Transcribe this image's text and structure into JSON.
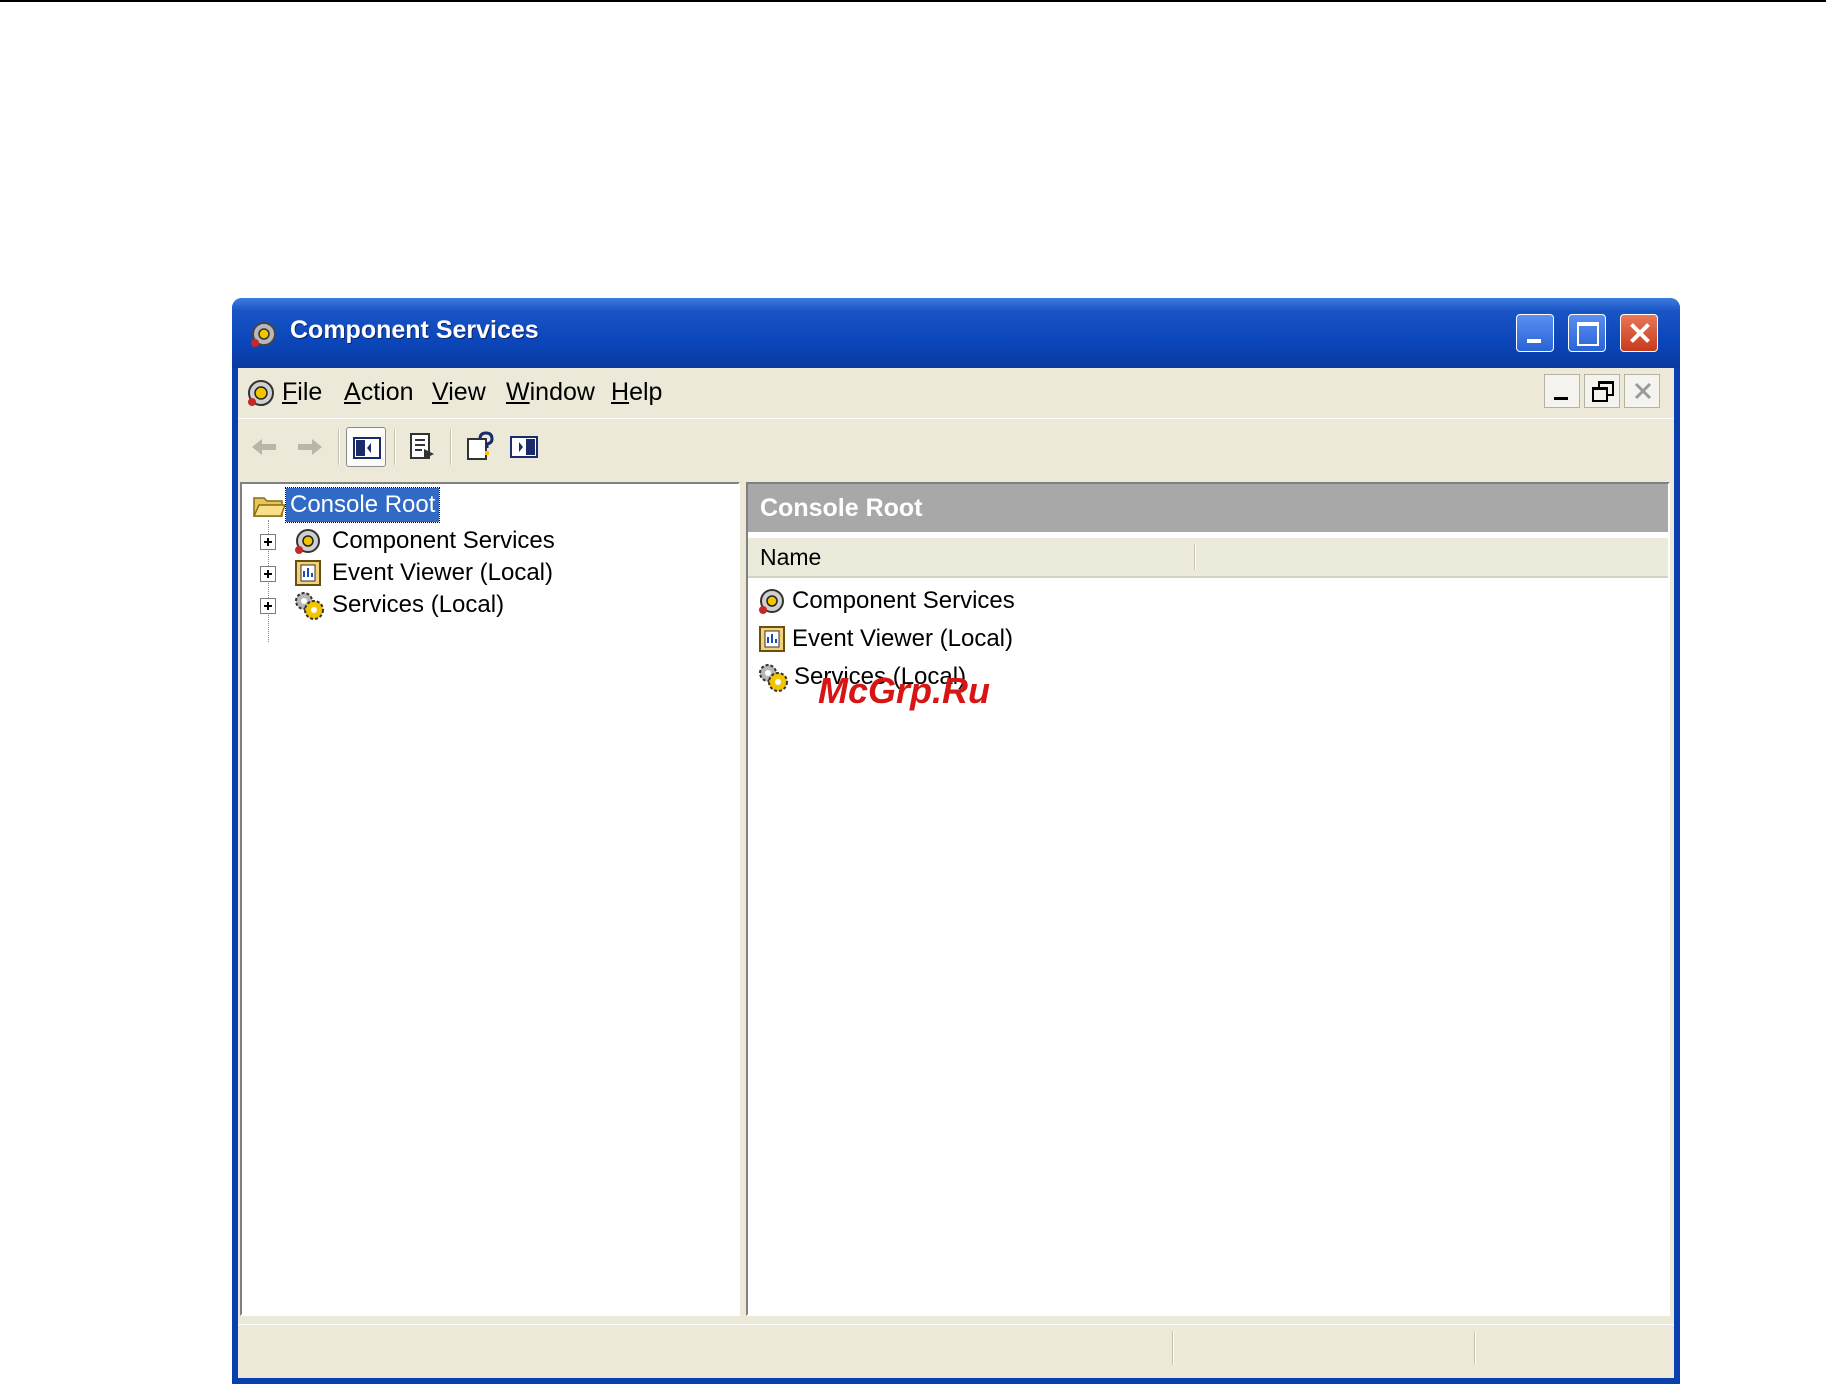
{
  "window": {
    "title": "Component Services"
  },
  "menubar": {
    "items": [
      {
        "label_mnemonic": "F",
        "label_rest": "ile"
      },
      {
        "label_mnemonic": "A",
        "label_rest": "ction"
      },
      {
        "label_mnemonic": "V",
        "label_rest": "iew"
      },
      {
        "label_mnemonic": "W",
        "label_rest": "indow"
      },
      {
        "label_mnemonic": "H",
        "label_rest": "elp"
      }
    ]
  },
  "tree": {
    "root_label": "Console Root",
    "items": [
      {
        "label": "Component Services",
        "icon": "component-services-icon"
      },
      {
        "label": "Event Viewer (Local)",
        "icon": "event-viewer-icon"
      },
      {
        "label": "Services (Local)",
        "icon": "services-gears-icon"
      }
    ]
  },
  "details": {
    "header": "Console Root",
    "column_name": "Name",
    "rows": [
      {
        "label": "Component Services",
        "icon": "component-services-icon"
      },
      {
        "label": "Event Viewer (Local)",
        "icon": "event-viewer-icon"
      },
      {
        "label": "Services (Local)",
        "icon": "services-gears-icon"
      }
    ]
  },
  "watermark": "McGrp.Ru",
  "colors": {
    "titlebar": "#0b47bb",
    "selection": "#316ac5",
    "pane_header": "#a8a8a8",
    "chrome": "#ece9d8",
    "watermark": "#d71515"
  }
}
